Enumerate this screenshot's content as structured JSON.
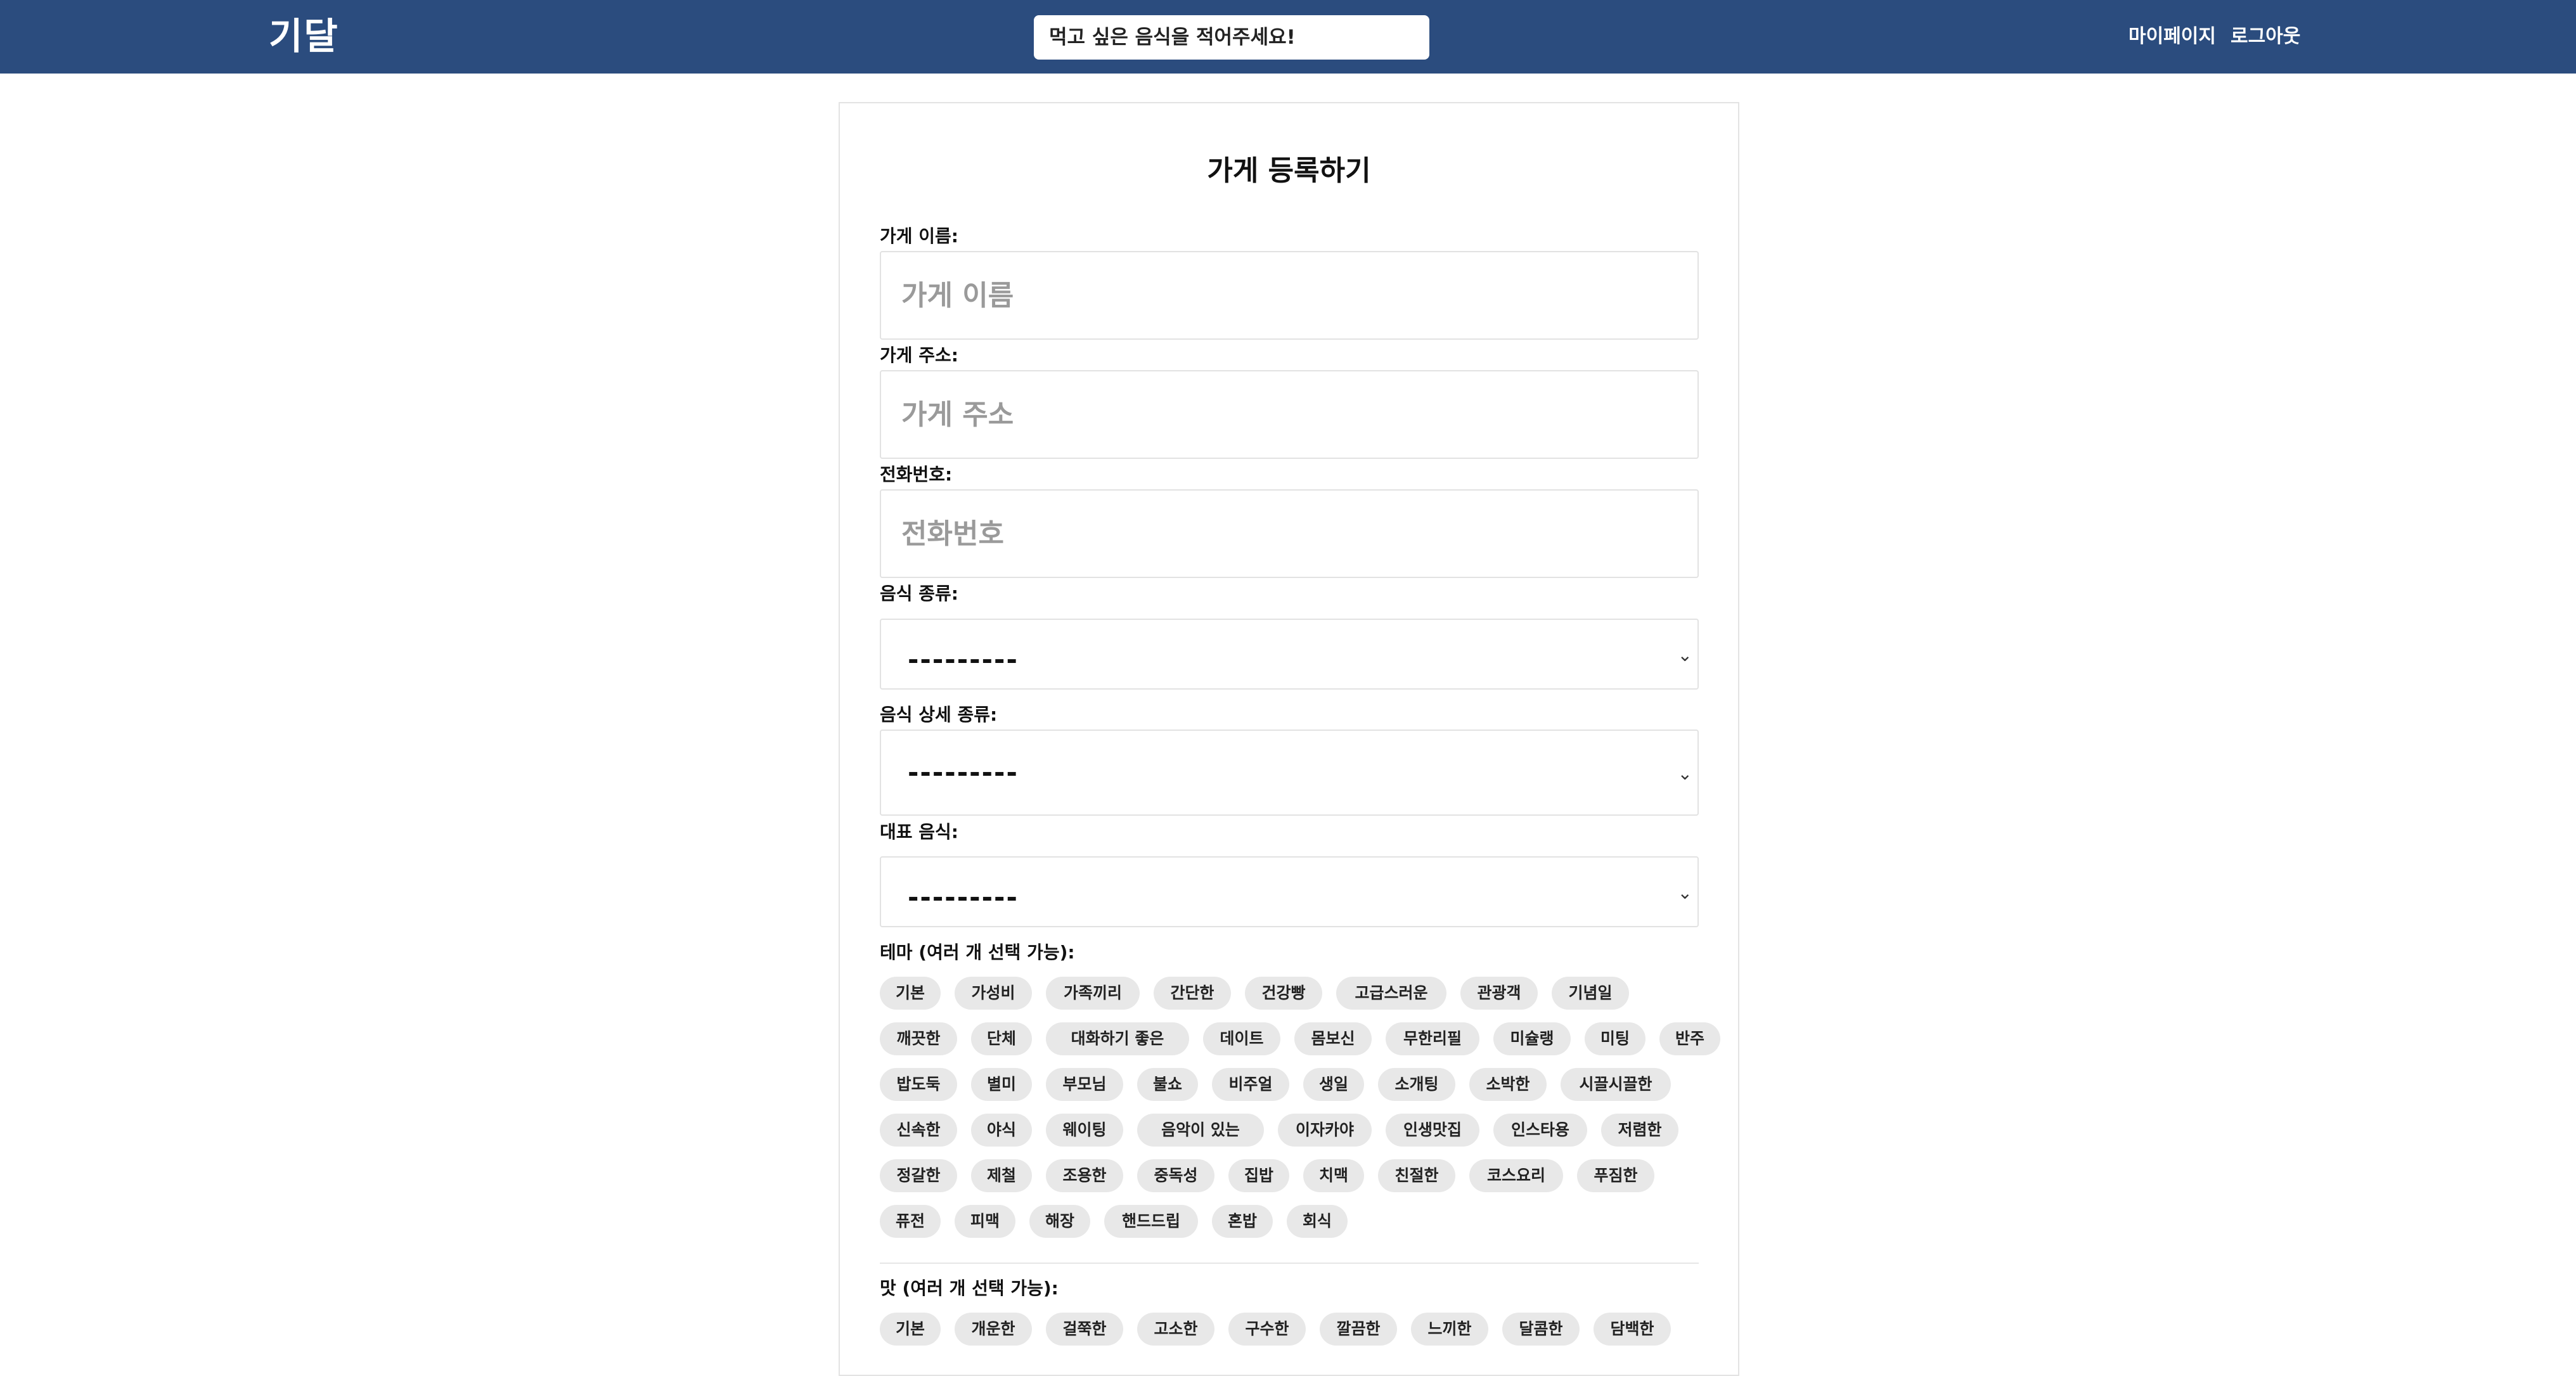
{
  "colors": {
    "nav": "#2b4c7e",
    "chip_bg": "#e8e8e8"
  },
  "header": {
    "logo": "기달",
    "search_placeholder": "먹고 싶은 음식을 적어주세요!",
    "mypage": "마이페이지",
    "logout": "로그아웃"
  },
  "form": {
    "title": "가게 등록하기",
    "name": {
      "label": "가게 이름:",
      "placeholder": "가게 이름"
    },
    "address": {
      "label": "가게 주소:",
      "placeholder": "가게 주소"
    },
    "phone": {
      "label": "전화번호:",
      "placeholder": "전화번호"
    },
    "category": {
      "label": "음식 종류:",
      "value": "---------"
    },
    "subcategory": {
      "label": "음식 상세 종류:",
      "value": "---------"
    },
    "main_food": {
      "label": "대표 음식:",
      "value": "---------"
    },
    "theme": {
      "label": "테마 (여러 개 선택 가능):",
      "rows": [
        [
          "기본",
          "가성비",
          "가족끼리",
          "간단한",
          "건강빵",
          "고급스러운",
          "관광객",
          "기념일"
        ],
        [
          "깨끗한",
          "단체",
          "대화하기 좋은",
          "데이트",
          "몸보신",
          "무한리필",
          "미슐랭",
          "미팅",
          "반주"
        ],
        [
          "밥도둑",
          "별미",
          "부모님",
          "불쇼",
          "비주얼",
          "생일",
          "소개팅",
          "소박한",
          "시끌시끌한"
        ],
        [
          "신속한",
          "야식",
          "웨이팅",
          "음악이 있는",
          "이자카야",
          "인생맛집",
          "인스타용",
          "저렴한"
        ],
        [
          "정갈한",
          "제철",
          "조용한",
          "중독성",
          "집밥",
          "치맥",
          "친절한",
          "코스요리",
          "푸짐한"
        ],
        [
          "퓨전",
          "피맥",
          "해장",
          "핸드드립",
          "혼밥",
          "회식"
        ]
      ]
    },
    "taste": {
      "label": "맛 (여러 개 선택 가능):",
      "rows": [
        [
          "기본",
          "개운한",
          "걸쭉한",
          "고소한",
          "구수한",
          "깔끔한",
          "느끼한",
          "달콤한",
          "담백한"
        ]
      ]
    }
  }
}
